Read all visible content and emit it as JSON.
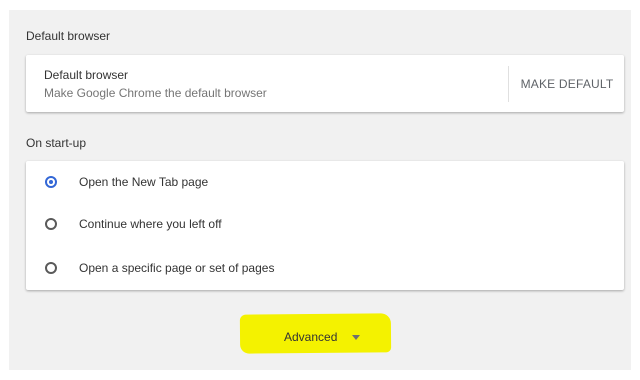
{
  "sections": {
    "default_browser_title": "Default browser",
    "startup_title": "On start-up"
  },
  "default_browser_card": {
    "title": "Default browser",
    "subtitle": "Make Google Chrome the default browser",
    "button_label": "MAKE DEFAULT"
  },
  "startup_options": [
    {
      "label": "Open the New Tab page",
      "selected": true
    },
    {
      "label": "Continue where you left off",
      "selected": false
    },
    {
      "label": "Open a specific page or set of pages",
      "selected": false
    }
  ],
  "advanced": {
    "label": "Advanced",
    "icon": "chevron-down-icon",
    "highlight_color": "#f4f200"
  },
  "colors": {
    "accent": "#3367d6",
    "background": "#f1f1f1",
    "card": "#ffffff"
  }
}
